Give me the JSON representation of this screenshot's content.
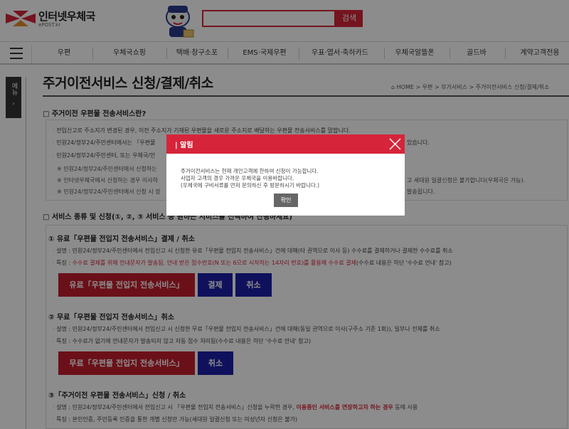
{
  "header": {
    "logo_main": "인터넷우체국",
    "logo_sub": "ePOST.kr",
    "search_placeholder": "",
    "search_button": "검색"
  },
  "nav": {
    "items": [
      "우편",
      "우체국쇼핑",
      "택배·창구소포",
      "EMS·국제우편",
      "우표·엽서·축하카드",
      "우체국알뜰폰",
      "골드바",
      "계약고객전용"
    ]
  },
  "side_tab": {
    "label": "메뉴",
    "arrow": "›"
  },
  "page": {
    "title": "주거이전서비스 신청/결제/취소",
    "breadcrumb": "HOME  >  우편  >  부가서비스  >  주거이전서비스 신청/결제/취소"
  },
  "section1": {
    "title": "□ 주거이전 우편물 전송서비스란?",
    "lines": [
      "전입신고로 주소지가 변경된 경우, 이전 주소지가 기재된 우편물을 새로운 주소지로 배달하는 우편물 전송서비스를 말합니다.",
      "민원24/정부24/주민센터에서는 「우편물",
      "있습니다.",
      "민원24/정부24/주민센터, 또는 우체국/인",
      "※ 민원24/정부24/주민센터에서 신청하는",
      "※ 인터넷우체국에서 신청하는 경우 이사하",
      "고 세대원 일괄신청은 불가합니다(우체국은 가능).",
      "※ 민원24/정부24/주민센터에서 신청 시 장",
      "발송됩니다."
    ]
  },
  "section2": {
    "title": "□ 서비스 종류 및 신청(①, ②, ③ 서비스 중 원하는 서비스를 선택하여 진행하세요)",
    "item1": {
      "head": "① 유료「우편물 전입지 전송서비스」결제 / 취소",
      "desc": "설명 : 민원24/정부24/주민센터에서 전입신고 시 신청한 유료「우편물 전입지 전송서비스」건에 대해(타 권역으로 이사 등) 수수료를 결제하거나 결제한 수수료를 취소",
      "feature_prefix": "특징 : ",
      "feature_red": "수수료 결제를 위해 안내문자가 발송됨. 안내 받은 접수번호(N 또는 6으로 시작하는 14자리 번호)를 활용해 수수료 결제",
      "feature_suffix": "(수수료 내용은 하단 '수수료 안내' 참고)",
      "btn_main": "유료「우편물 전입지 전송서비스」",
      "btn_pay": "결제",
      "btn_cancel": "취소"
    },
    "item2": {
      "head": "② 무료「우편물 전입지 전송서비스」취소",
      "desc": "설명 : 민원24/정부24/주민센터에서 전입신고 시 신청한 무료「우편물 전입지 전송서비스」건에 대해(동일 권역으로 이사(구주소 기준 1회)), 일부나 전체를 취소",
      "feature": "특징 : 수수료가 없기에 안내문자가 발송되지 않고 자동 접수 처리됨(수수료 내용은 하단 '수수료 안내' 참고)",
      "btn_main": "무료「우편물 전입지 전송서비스」",
      "btn_cancel": "취소"
    },
    "item3": {
      "head": "③「주거이전 우편물 전송서비스」신청 / 취소",
      "desc_prefix": "설명 : 민원24/정부24/주민센터에서 전입신고 시 「우편물 전입지 전송서비스」신청을 누락한 경우, ",
      "desc_red": "이용중인 서비스를 연장하고자 하는 경우",
      "desc_suffix": " 등에 사용",
      "feature": "특징 : 본인인증, 주민등록 인증을 통한 개별 신청만 가능(세대원 일괄신청 또는 미성년자 신청은 불가)"
    }
  },
  "modal": {
    "title": "알림",
    "body": [
      "주거이전서비스는 현재 개인고객에 한하여 신청이 가능합니다.",
      "사업자 고객의 경우 가까운 우체국을 이용바랍니다.",
      "(우체국에 구비서류를 먼저 문의하신 후 방문하시기 바랍니다.)"
    ],
    "ok": "확인"
  },
  "colors": {
    "brand_red": "#d6253a",
    "button_blue": "#1d1fa8",
    "button_red": "#c41e2e"
  }
}
